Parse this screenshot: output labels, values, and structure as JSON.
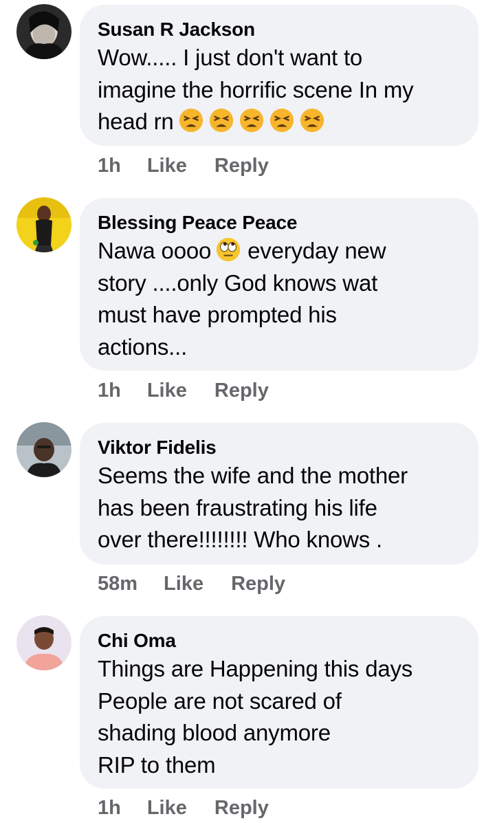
{
  "comments": [
    {
      "author": "Susan R Jackson",
      "lines": [
        "Wow..... I just don't want to",
        "imagine the horrific scene In my",
        "head rn"
      ],
      "emoji": [
        "tired-face-emoji",
        "tired-face-emoji",
        "tired-face-emoji",
        "tired-face-emoji",
        "tired-face-emoji"
      ],
      "time": "1h",
      "like_label": "Like",
      "reply_label": "Reply"
    },
    {
      "author": "Blessing Peace Peace",
      "lines": [
        "Nawa oooo",
        "story ....only God knows wat",
        "must have prompted his",
        "actions..."
      ],
      "line1_suffix": " everyday new",
      "emoji": [
        "rolling-eyes-emoji"
      ],
      "time": "1h",
      "like_label": "Like",
      "reply_label": "Reply"
    },
    {
      "author": "Viktor Fidelis",
      "lines": [
        "Seems the wife and the mother",
        "has been fraustrating his life",
        "over there!!!!!!!! Who knows ."
      ],
      "time": "58m",
      "like_label": "Like",
      "reply_label": "Reply"
    },
    {
      "author": "Chi Oma",
      "lines": [
        "Things are Happening this days",
        "People are not scared of",
        "shading blood anymore",
        "RIP to them"
      ],
      "time": "1h",
      "like_label": "Like",
      "reply_label": "Reply"
    }
  ],
  "colors": {
    "bubble": "#f0f2f5",
    "meta_text": "#65676b",
    "text": "#050505"
  }
}
